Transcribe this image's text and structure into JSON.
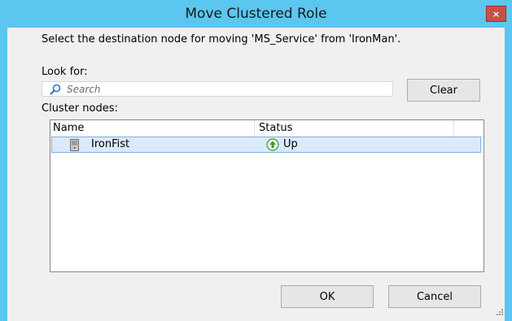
{
  "window": {
    "title": "Move Clustered Role",
    "close_glyph": "×"
  },
  "dialog": {
    "prompt": "Select the destination node for moving 'MS_Service' from 'IronMan'.",
    "look_for_label": "Look for:",
    "search_placeholder": "Search",
    "clear_label": "Clear",
    "cluster_nodes_label": "Cluster nodes:",
    "ok_label": "OK",
    "cancel_label": "Cancel"
  },
  "table": {
    "columns": [
      "Name",
      "Status"
    ],
    "rows": [
      {
        "name": "IronFist",
        "status": "Up",
        "icon": "server-icon",
        "status_icon": "up-arrow-icon"
      }
    ]
  },
  "colors": {
    "frame": "#5bc6ef",
    "close": "#c7504a",
    "selection": "#dbeaf9",
    "status_up": "#3a9a3a"
  }
}
